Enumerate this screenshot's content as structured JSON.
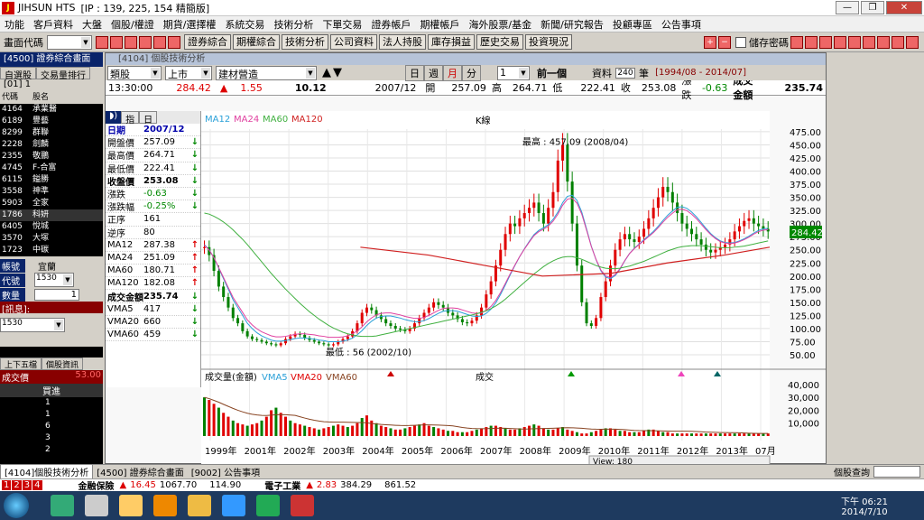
{
  "window": {
    "title": "JIHSUN HTS",
    "ip_label": "[IP : 139, 225, 154 精簡版]"
  },
  "menu": [
    "功能",
    "客戶資料",
    "大盤",
    "個股/權證",
    "期貨/選擇權",
    "系統交易",
    "技術分析",
    "下單交易",
    "證券帳戶",
    "期權帳戶",
    "海外股票/基金",
    "新聞/研究報告",
    "投顧專區",
    "公告事項"
  ],
  "toolbar": {
    "label": "畫面代碼",
    "buttons": [
      "證券綜合",
      "期權綜合",
      "技術分析",
      "公司資料",
      "法人持股",
      "庫存損益",
      "歷史交易",
      "投資現況"
    ],
    "checkbox_label": "儲存密碼"
  },
  "left_panel": {
    "title": "[4500] 證券綜合畫面",
    "tabs": [
      "自選股",
      "交易量排行"
    ],
    "group": "[01] 1",
    "header": [
      "代碼",
      "股名"
    ],
    "rows": [
      {
        "code": "4164",
        "name": "承業醫"
      },
      {
        "code": "6189",
        "name": "豐藝"
      },
      {
        "code": "8299",
        "name": "群聯"
      },
      {
        "code": "2228",
        "name": "劍麟"
      },
      {
        "code": "2355",
        "name": "敬鵬"
      },
      {
        "code": "4745",
        "name": "F-合富"
      },
      {
        "code": "6115",
        "name": "鎰勝"
      },
      {
        "code": "3558",
        "name": "神準"
      },
      {
        "code": "5903",
        "name": "全家"
      },
      {
        "code": "1786",
        "name": "科妍"
      },
      {
        "code": "6405",
        "name": "悅城"
      },
      {
        "code": "3570",
        "name": "大塚"
      },
      {
        "code": "1723",
        "name": "中碳"
      }
    ],
    "order_tabs": [
      "帳號",
      "代號",
      "數量"
    ],
    "account": "宜蘭",
    "code": "1530",
    "qty": "1",
    "msg": "[訊息]:",
    "code2": "1530",
    "five_tab": "上下五檔",
    "five_tab2": "個股資訊",
    "deal_label": "成交價",
    "deal_value": "53.00",
    "buy_label": "買進",
    "buy_qty": [
      "1",
      "1",
      "6",
      "3",
      "2"
    ]
  },
  "chart_win": {
    "title": "[4104] 個股技術分析",
    "market_type": "類股",
    "market": "上市",
    "sector": "建材營造",
    "period_buttons": [
      "日",
      "週",
      "月",
      "分"
    ],
    "period_num": "1",
    "prev_label": "前一個",
    "data_label": "資料",
    "data_count": "240",
    "data_unit": "筆",
    "range": "[1994/08 - 2014/07]",
    "time": "13:30:00",
    "index": "284.42",
    "change": "1.55",
    "amount": "10.12",
    "date": "2007/12",
    "open_lbl": "開",
    "open": "257.09",
    "high_lbl": "高",
    "high": "264.71",
    "low_lbl": "低",
    "low": "222.41",
    "close_lbl": "收",
    "close": "253.08",
    "chg_lbl": "漲跌",
    "chg": "-0.63",
    "vol_lbl": "成交金額",
    "vol": "235.74",
    "info_tabs": [
      "指",
      "日"
    ],
    "info_date_lbl": "日期",
    "info_date": "2007/12",
    "info": [
      {
        "l": "開盤價",
        "v": "257.09",
        "a": "dn"
      },
      {
        "l": "最高價",
        "v": "264.71",
        "a": "dn"
      },
      {
        "l": "最低價",
        "v": "222.41",
        "a": "dn"
      },
      {
        "l": "收盤價",
        "v": "253.08",
        "a": "dn"
      },
      {
        "l": "漲跌",
        "v": "-0.63",
        "a": "dn"
      },
      {
        "l": "漲跌幅",
        "v": "-0.25%",
        "a": "dn"
      },
      {
        "l": "正序",
        "v": "161",
        "a": ""
      },
      {
        "l": "逆序",
        "v": "80",
        "a": ""
      },
      {
        "l": "MA12",
        "v": "287.38",
        "a": "up"
      },
      {
        "l": "MA24",
        "v": "251.09",
        "a": "up"
      },
      {
        "l": "MA60",
        "v": "180.71",
        "a": "up"
      },
      {
        "l": "MA120",
        "v": "182.08",
        "a": "up"
      },
      {
        "l": "成交金額",
        "v": "235.74",
        "a": "dn"
      },
      {
        "l": "VMA5",
        "v": "417",
        "a": "dn"
      },
      {
        "l": "VMA20",
        "v": "660",
        "a": "dn"
      },
      {
        "l": "VMA60",
        "v": "459",
        "a": "dn"
      }
    ],
    "legend_ma": [
      "MA12",
      "MA24",
      "MA60",
      "MA120"
    ],
    "k_label": "K線",
    "max_label": "最高 : 457.09 (2008/04)",
    "min_label": "最低 : 56 (2002/10)",
    "legend_vol": [
      "成交量(金額)",
      "VMA5",
      "VMA20",
      "VMA60"
    ],
    "vol_label": "成交",
    "current_tag": "284.42",
    "view_label": "View:",
    "view_val": "180",
    "colors": {
      "ma12": "#2aa0d8",
      "ma24": "#e040a0",
      "ma60": "#40b040",
      "ma120": "#d02020",
      "up": "#e00000",
      "dn": "#008000"
    }
  },
  "chart_data": {
    "type": "candlestick",
    "x_ticks": [
      "1999年",
      "2001年",
      "2002年",
      "2003年",
      "2004年",
      "2005年",
      "2006年",
      "2007年",
      "2008年",
      "2009年",
      "2010年",
      "2011年",
      "2012年",
      "2013年",
      "07月"
    ],
    "y_ticks": [
      475,
      450,
      425,
      400,
      375,
      350,
      325,
      300,
      275,
      250,
      225,
      200,
      175,
      150,
      125,
      100,
      75,
      50
    ],
    "y_tick_labels": [
      "475.00",
      "450.00",
      "425.00",
      "400.00",
      "375.00",
      "350.00",
      "325.00",
      "300.00",
      "275.00",
      "250.00",
      "225.00",
      "200.00",
      "175.00",
      "150.00",
      "125.00",
      "100.00",
      "75.00",
      "50.00"
    ],
    "vol_ticks": [
      "40,000",
      "30,000",
      "20,000",
      "10,000"
    ],
    "ylim": [
      50,
      480
    ],
    "close_series": [
      255,
      240,
      210,
      180,
      160,
      140,
      120,
      110,
      95,
      85,
      80,
      78,
      75,
      72,
      70,
      68,
      72,
      80,
      85,
      90,
      88,
      82,
      78,
      75,
      72,
      70,
      68,
      70,
      75,
      80,
      85,
      95,
      110,
      130,
      140,
      135,
      125,
      118,
      110,
      105,
      100,
      98,
      95,
      100,
      110,
      120,
      130,
      140,
      150,
      145,
      140,
      130,
      125,
      118,
      112,
      110,
      115,
      125,
      140,
      165,
      190,
      220,
      250,
      280,
      300,
      295,
      310,
      320,
      330,
      340,
      320,
      300,
      330,
      360,
      420,
      450,
      380,
      300,
      220,
      150,
      110,
      105,
      120,
      160,
      190,
      220,
      250,
      270,
      280,
      270,
      265,
      275,
      290,
      310,
      330,
      350,
      370,
      360,
      340,
      320,
      300,
      290,
      280,
      270,
      260,
      250,
      245,
      250,
      255,
      260,
      270,
      285,
      295,
      305,
      310,
      300,
      295,
      290,
      285
    ],
    "ma12_series": [
      260,
      250,
      235,
      215,
      195,
      175,
      155,
      140,
      125,
      110,
      100,
      92,
      86,
      82,
      78,
      76,
      76,
      77,
      79,
      81,
      82,
      82,
      81,
      80,
      78,
      77,
      75,
      75,
      75,
      76,
      78,
      82,
      88,
      96,
      106,
      114,
      120,
      123,
      124,
      124,
      122,
      120,
      117,
      115,
      113,
      113,
      115,
      119,
      124,
      129,
      133,
      134,
      134,
      133,
      130,
      127,
      124,
      123,
      124,
      129,
      137,
      149,
      165,
      183,
      202,
      220,
      237,
      252,
      266,
      279,
      287,
      292,
      298,
      308,
      322,
      340,
      352,
      354,
      344,
      322,
      290,
      257,
      231,
      210,
      198,
      195,
      201,
      213,
      229,
      243,
      253,
      261,
      269,
      277,
      285,
      295,
      306,
      316,
      324,
      331,
      332,
      329,
      322,
      313,
      302,
      291,
      281,
      273,
      267,
      264,
      263,
      264,
      267,
      271,
      276,
      282,
      287,
      290,
      291
    ],
    "ma60_series": [
      320,
      318,
      314,
      309,
      303,
      296,
      288,
      279,
      270,
      260,
      249,
      238,
      227,
      216,
      205,
      195,
      185,
      175,
      166,
      157,
      148,
      140,
      132,
      125,
      118,
      112,
      106,
      101,
      97,
      93,
      90,
      88,
      86,
      85,
      85,
      85,
      86,
      88,
      90,
      92,
      94,
      96,
      98,
      100,
      102,
      104,
      106,
      108,
      110,
      112,
      114,
      116,
      118,
      120,
      122,
      124,
      126,
      128,
      131,
      134,
      138,
      143,
      149,
      156,
      164,
      172,
      180,
      188,
      196,
      204,
      211,
      218,
      224,
      229,
      233,
      236,
      237,
      237,
      235,
      232,
      228,
      224,
      220,
      217,
      215,
      214,
      214,
      215,
      217,
      219,
      222,
      225,
      228,
      232,
      236,
      240,
      244,
      248,
      251,
      254,
      256,
      257,
      258,
      258,
      258,
      257,
      256,
      255,
      254,
      254,
      254,
      255,
      256,
      257,
      259,
      261,
      263,
      265,
      267
    ],
    "ma120_series": [
      null,
      null,
      null,
      null,
      null,
      null,
      null,
      null,
      null,
      null,
      null,
      null,
      null,
      null,
      null,
      null,
      null,
      null,
      null,
      null,
      null,
      null,
      null,
      null,
      null,
      null,
      null,
      null,
      null,
      null,
      null,
      null,
      null,
      null,
      null,
      null,
      null,
      null,
      null,
      null,
      null,
      null,
      null,
      null,
      null,
      null,
      null,
      null,
      null,
      null,
      null,
      null,
      null,
      null,
      null,
      null,
      null,
      null,
      null,
      null,
      null,
      null,
      null,
      null,
      null,
      null,
      null,
      null,
      null,
      null,
      null,
      null,
      null,
      null,
      null,
      null,
      null,
      null,
      null,
      null,
      null,
      null,
      null,
      null,
      null,
      null,
      null,
      null,
      null,
      null,
      null,
      null,
      null,
      null,
      null,
      null,
      null,
      null,
      null,
      null,
      null,
      null,
      null,
      null,
      null,
      null,
      null,
      null,
      null,
      null,
      null,
      null,
      null,
      null,
      null,
      null,
      null,
      null
    ],
    "ma120_line": [
      [
        0.28,
        255
      ],
      [
        0.4,
        240
      ],
      [
        0.5,
        220
      ],
      [
        0.6,
        200
      ],
      [
        0.72,
        205
      ],
      [
        0.82,
        225
      ],
      [
        0.92,
        240
      ],
      [
        1.0,
        255
      ]
    ],
    "volume": [
      30000,
      28000,
      25000,
      22000,
      18000,
      15000,
      12000,
      10000,
      9000,
      8000,
      9000,
      10000,
      12000,
      15000,
      20000,
      22000,
      18000,
      15000,
      12000,
      10000,
      9000,
      8000,
      7000,
      6000,
      5000,
      6000,
      7000,
      8000,
      9000,
      8000,
      7000,
      8000,
      10000,
      14000,
      16000,
      12000,
      10000,
      8000,
      7000,
      6000,
      5000,
      5000,
      6000,
      7000,
      8000,
      9000,
      10000,
      8000,
      7000,
      6000,
      5000,
      4000,
      4000,
      3000,
      3000,
      3000,
      4000,
      5000,
      6000,
      7000,
      8000,
      8000,
      7000,
      6000,
      5000,
      5000,
      6000,
      7000,
      8000,
      9000,
      8000,
      6000,
      5000,
      5000,
      6000,
      7000,
      5000,
      4000,
      3000,
      2000,
      2000,
      3000,
      4000,
      5000,
      6000,
      6000,
      5000,
      4000,
      4000,
      3000,
      3000,
      3000,
      4000,
      5000,
      5000,
      4000,
      3000,
      3000,
      2000,
      2000,
      2000,
      2000,
      2000,
      2000,
      2000,
      2000,
      2000,
      2000,
      2000,
      2000,
      2000,
      2000,
      2000,
      2000,
      2000,
      2000,
      2000,
      2000,
      2000
    ]
  },
  "tabs_row": [
    "[4104]個股技術分析",
    "[4500] 證券綜合畫面",
    "[9002] 公告事項"
  ],
  "tabs_right": "個股查詢",
  "status": {
    "pages": [
      "1",
      "2",
      "3",
      "4"
    ],
    "s1_name": "金融保險",
    "s1_chg": "16.45",
    "s1_val": "1067.70",
    "s1_amt": "114.90",
    "s2_name": "電子工業",
    "s2_chg": "2.83",
    "s2_val": "384.29",
    "s2_amt": "861.52"
  },
  "taskbar": {
    "time": "下午 06:21",
    "date": "2014/7/10"
  }
}
